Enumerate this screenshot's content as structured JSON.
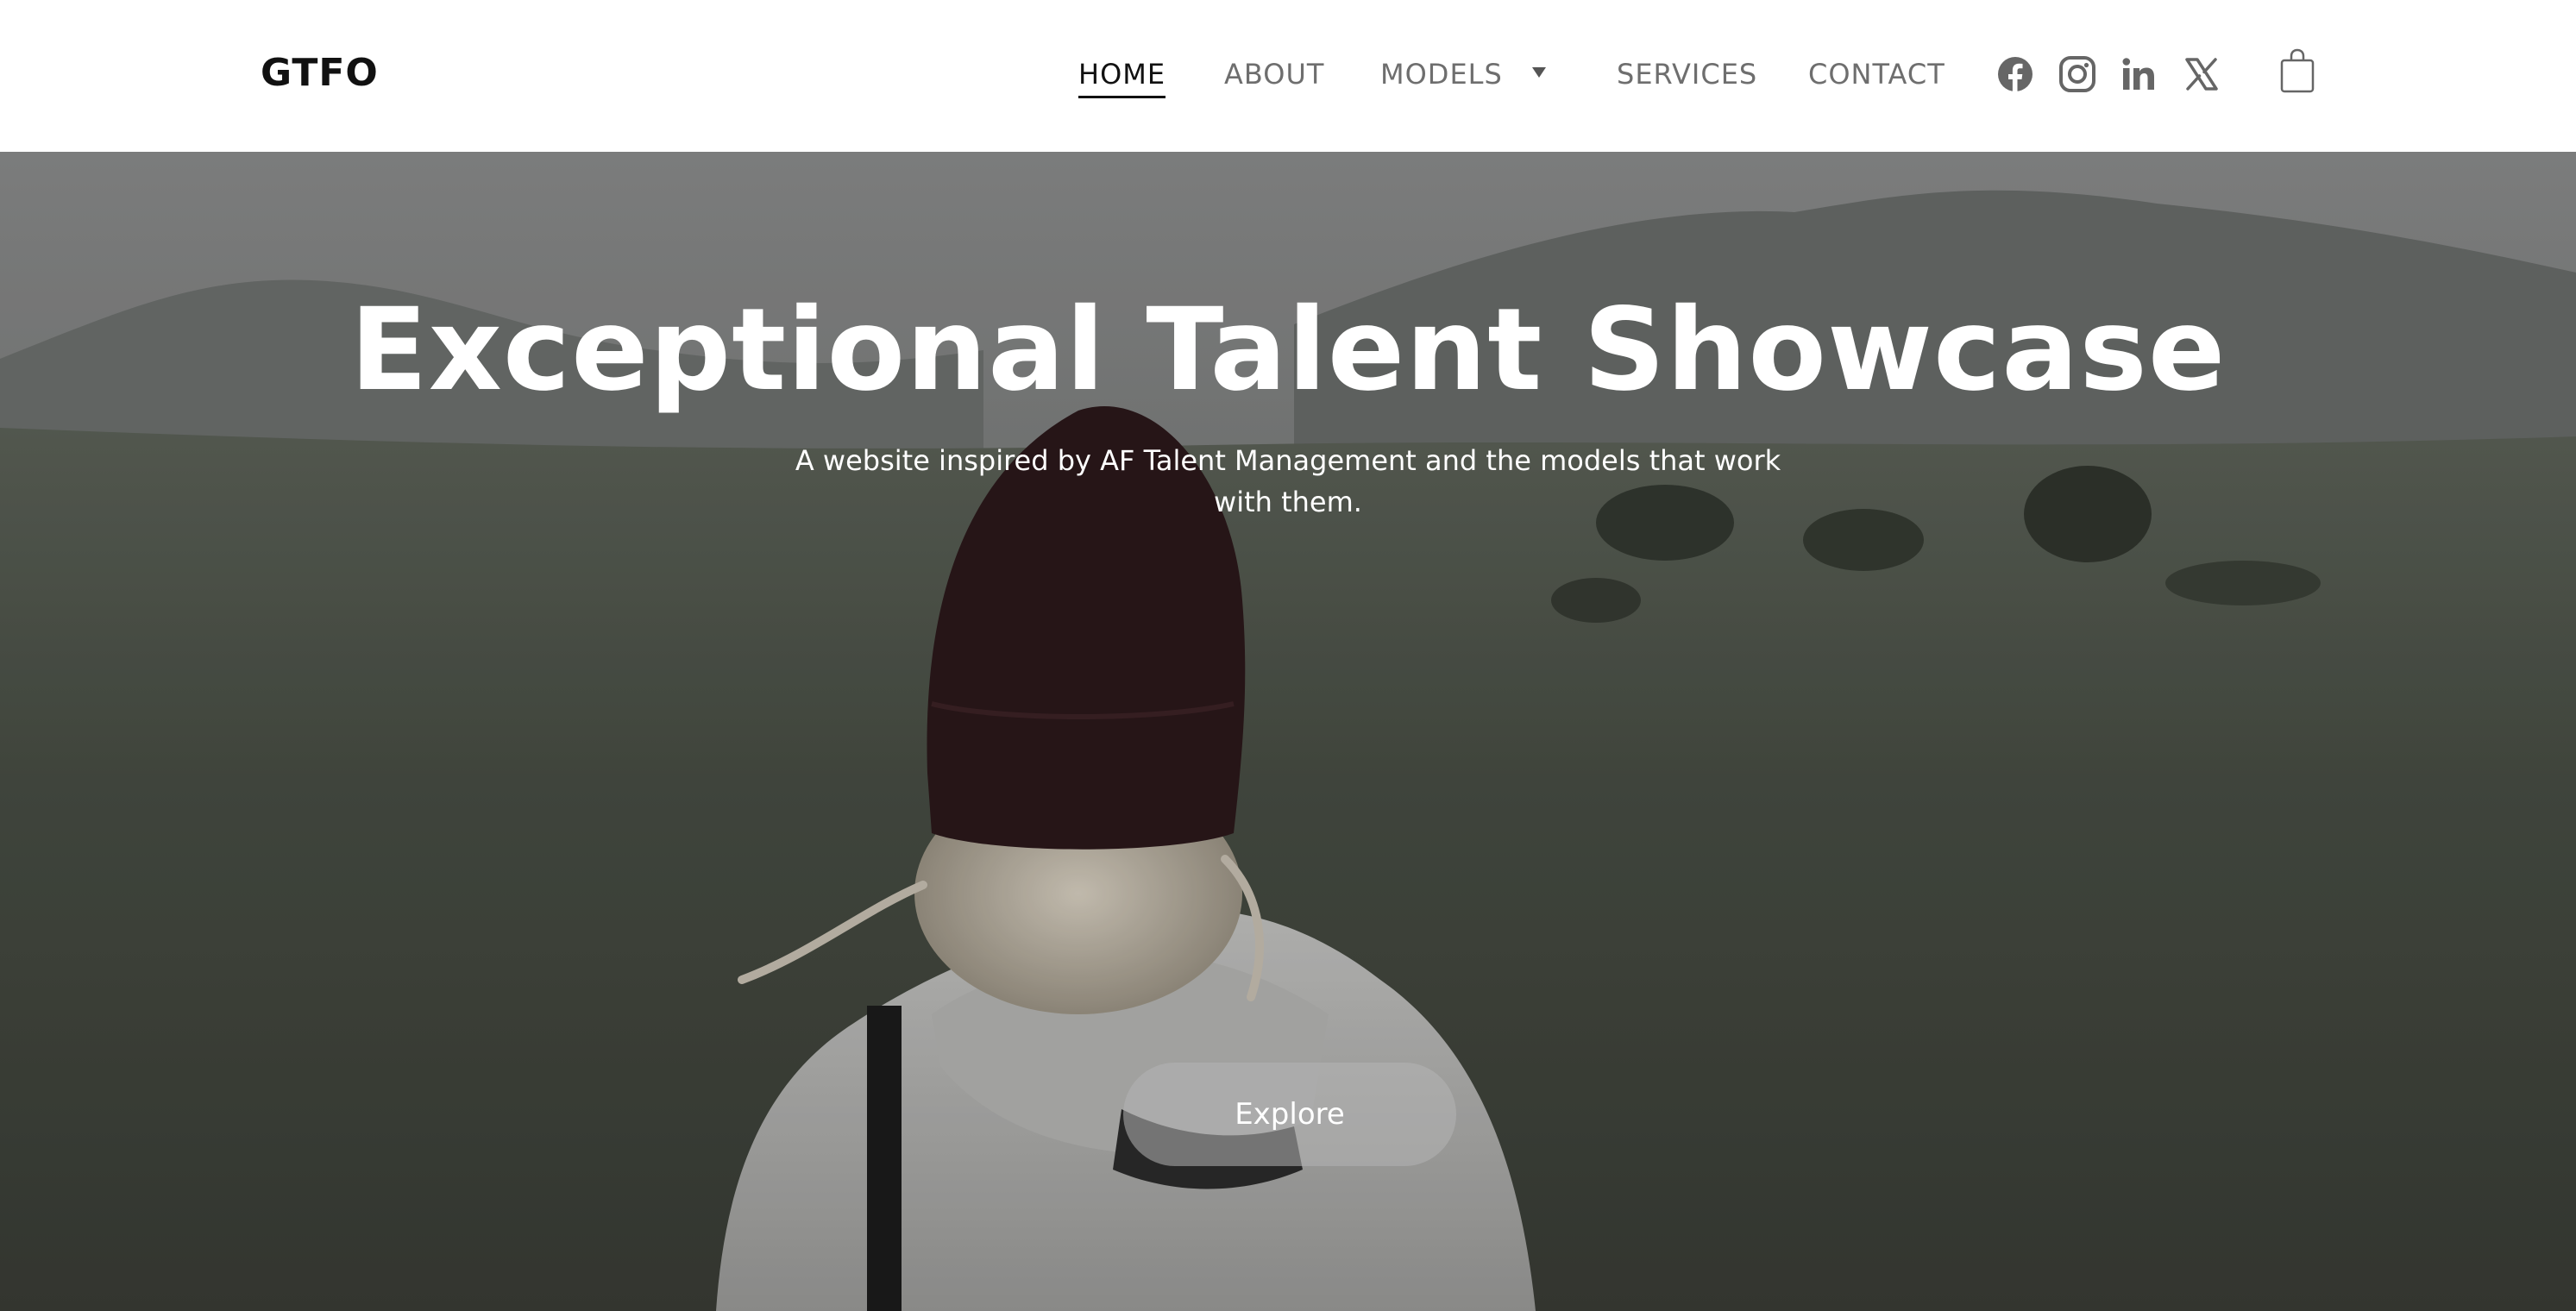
{
  "header": {
    "logo": "GTFO",
    "nav": [
      {
        "label": "HOME",
        "active": true
      },
      {
        "label": "ABOUT",
        "active": false
      },
      {
        "label": "MODELS",
        "active": false,
        "has_dropdown": true
      },
      {
        "label": "SERVICES",
        "active": false
      },
      {
        "label": "CONTACT",
        "active": false
      }
    ],
    "social_icons": [
      "facebook-icon",
      "instagram-icon",
      "linkedin-icon",
      "x-icon"
    ],
    "cart_icon": "shopping-bag-icon"
  },
  "hero": {
    "title": "Exceptional Talent Showcase",
    "subtitle": "A website inspired by AF Talent Management and the models that work with them.",
    "cta_label": "Explore",
    "background_image": "person-in-beanie-facing-hills"
  },
  "colors": {
    "header_bg": "#ffffff",
    "nav_text": "#6e6e6e",
    "nav_active": "#111111",
    "hero_text": "#ffffff",
    "button_bg": "#b4b4b4"
  }
}
